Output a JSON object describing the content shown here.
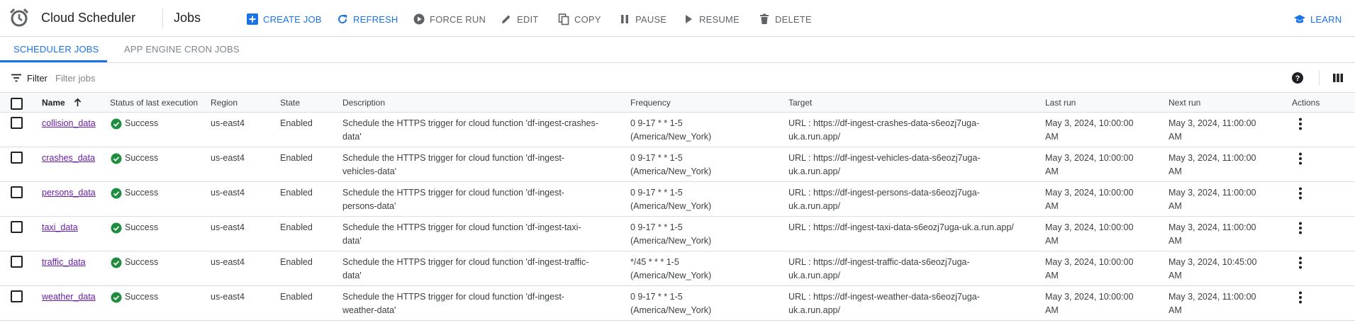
{
  "header": {
    "app_title": "Cloud Scheduler",
    "page_title": "Jobs",
    "buttons": {
      "create_job": "CREATE JOB",
      "refresh": "REFRESH",
      "force_run": "FORCE RUN",
      "edit": "EDIT",
      "copy": "COPY",
      "pause": "PAUSE",
      "resume": "RESUME",
      "delete": "DELETE",
      "learn": "LEARN"
    }
  },
  "tabs": [
    {
      "label": "SCHEDULER JOBS",
      "active": true
    },
    {
      "label": "APP ENGINE CRON JOBS",
      "active": false
    }
  ],
  "filter": {
    "label": "Filter",
    "placeholder": "Filter jobs"
  },
  "table": {
    "columns": {
      "name": "Name",
      "status": "Status of last execution",
      "region": "Region",
      "state": "State",
      "description": "Description",
      "frequency": "Frequency",
      "target": "Target",
      "last_run": "Last run",
      "next_run": "Next run",
      "actions": "Actions"
    },
    "rows": [
      {
        "name": "collision_data",
        "status": "Success",
        "region": "us-east4",
        "state": "Enabled",
        "description_1": "Schedule the HTTPS trigger for cloud function 'df-ingest-crashes-",
        "description_2": "data'",
        "frequency_1": "0 9-17 * * 1-5",
        "frequency_2": "(America/New_York)",
        "target_1": "URL : https://df-ingest-crashes-data-s6eozj7uga-",
        "target_2": "uk.a.run.app/",
        "last_run_1": "May 3, 2024, 10:00:00",
        "last_run_2": "AM",
        "next_run_1": "May 3, 2024, 11:00:00",
        "next_run_2": "AM"
      },
      {
        "name": "crashes_data",
        "status": "Success",
        "region": "us-east4",
        "state": "Enabled",
        "description_1": "Schedule the HTTPS trigger for cloud function 'df-ingest-",
        "description_2": "vehicles-data'",
        "frequency_1": "0 9-17 * * 1-5",
        "frequency_2": "(America/New_York)",
        "target_1": "URL : https://df-ingest-vehicles-data-s6eozj7uga-",
        "target_2": "uk.a.run.app/",
        "last_run_1": "May 3, 2024, 10:00:00",
        "last_run_2": "AM",
        "next_run_1": "May 3, 2024, 11:00:00",
        "next_run_2": "AM"
      },
      {
        "name": "persons_data",
        "status": "Success",
        "region": "us-east4",
        "state": "Enabled",
        "description_1": "Schedule the HTTPS trigger for cloud function 'df-ingest-",
        "description_2": "persons-data'",
        "frequency_1": "0 9-17 * * 1-5",
        "frequency_2": "(America/New_York)",
        "target_1": "URL : https://df-ingest-persons-data-s6eozj7uga-",
        "target_2": "uk.a.run.app/",
        "last_run_1": "May 3, 2024, 10:00:00",
        "last_run_2": "AM",
        "next_run_1": "May 3, 2024, 11:00:00",
        "next_run_2": "AM"
      },
      {
        "name": "taxi_data",
        "status": "Success",
        "region": "us-east4",
        "state": "Enabled",
        "description_1": "Schedule the HTTPS trigger for cloud function 'df-ingest-taxi-",
        "description_2": "data'",
        "frequency_1": "0 9-17 * * 1-5",
        "frequency_2": "(America/New_York)",
        "target_1": "URL : https://df-ingest-taxi-data-s6eozj7uga-uk.a.run.app/",
        "target_2": "",
        "last_run_1": "May 3, 2024, 10:00:00",
        "last_run_2": "AM",
        "next_run_1": "May 3, 2024, 11:00:00",
        "next_run_2": "AM"
      },
      {
        "name": "traffic_data",
        "status": "Success",
        "region": "us-east4",
        "state": "Enabled",
        "description_1": "Schedule the HTTPS trigger for cloud function 'df-ingest-traffic-",
        "description_2": "data'",
        "frequency_1": "*/45 * * * 1-5",
        "frequency_2": "(America/New_York)",
        "target_1": "URL : https://df-ingest-traffic-data-s6eozj7uga-",
        "target_2": "uk.a.run.app/",
        "last_run_1": "May 3, 2024, 10:00:00",
        "last_run_2": "AM",
        "next_run_1": "May 3, 2024, 10:45:00",
        "next_run_2": "AM"
      },
      {
        "name": "weather_data",
        "status": "Success",
        "region": "us-east4",
        "state": "Enabled",
        "description_1": "Schedule the HTTPS trigger for cloud function 'df-ingest-",
        "description_2": "weather-data'",
        "frequency_1": "0 9-17 * * 1-5",
        "frequency_2": "(America/New_York)",
        "target_1": "URL : https://df-ingest-weather-data-s6eozj7uga-",
        "target_2": "uk.a.run.app/",
        "last_run_1": "May 3, 2024, 10:00:00",
        "last_run_2": "AM",
        "next_run_1": "May 3, 2024, 11:00:00",
        "next_run_2": "AM"
      }
    ]
  }
}
